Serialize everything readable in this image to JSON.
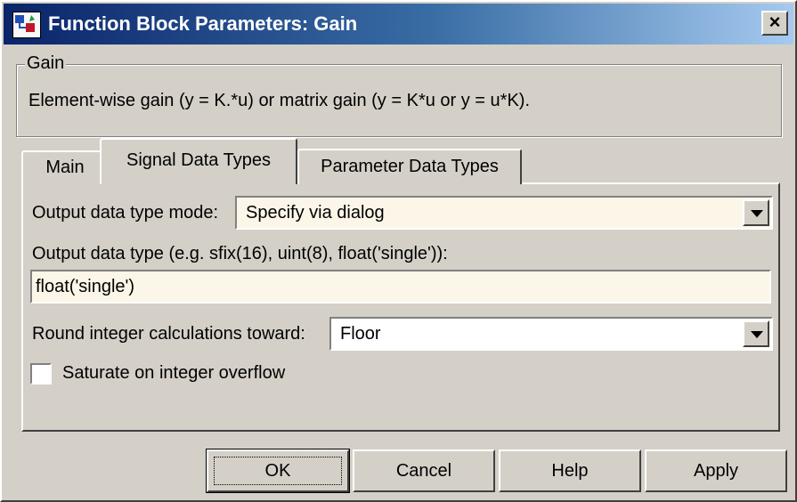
{
  "window": {
    "title": "Function Block Parameters: Gain",
    "close_label": "×",
    "icon": "simulink-block-icon"
  },
  "group": {
    "title": "Gain",
    "description": "Element-wise gain (y = K.*u) or matrix gain (y = K*u or y = u*K)."
  },
  "tabs": [
    {
      "label": "Main",
      "active": false
    },
    {
      "label": "Signal Data Types",
      "active": true
    },
    {
      "label": "Parameter Data Types",
      "active": false
    }
  ],
  "form": {
    "output_mode_label": "Output data type mode:",
    "output_mode_value": "Specify via dialog",
    "output_type_label": "Output data type (e.g. sfix(16), uint(8), float('single')):",
    "output_type_value": "float('single')",
    "round_label": "Round integer calculations toward:",
    "round_value": "Floor",
    "saturate_label": "Saturate on integer overflow",
    "saturate_checked": false
  },
  "buttons": {
    "ok": "OK",
    "cancel": "Cancel",
    "help": "Help",
    "apply": "Apply"
  },
  "colors": {
    "title_gradient_start": "#0a246a",
    "title_gradient_end": "#a6caf0",
    "dialog_bg": "#d4d0c8",
    "field_bg": "#fcf6e9"
  }
}
